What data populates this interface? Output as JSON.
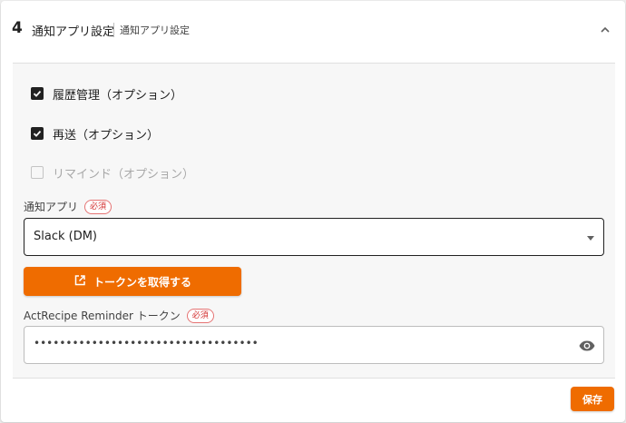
{
  "header": {
    "step_number": "4",
    "title": "通知アプリ設定",
    "subtitle": "通知アプリ設定",
    "collapse_icon": "chevron-up-icon"
  },
  "options": [
    {
      "label": "履歴管理（オプション）",
      "checked": true,
      "disabled": false
    },
    {
      "label": "再送（オプション）",
      "checked": true,
      "disabled": false
    },
    {
      "label": "リマインド（オプション）",
      "checked": false,
      "disabled": true
    }
  ],
  "notify_app": {
    "label": "通知アプリ",
    "required": "必須",
    "value": "Slack (DM)",
    "dropdown_icon": "caret-down-icon"
  },
  "token_button": {
    "label": "トークンを取得する",
    "icon": "open-in-new-icon"
  },
  "reminder_token": {
    "label": "ActRecipe Reminder トークン",
    "required": "必須",
    "value": "•••••••••••••••••••••••••••••••••••",
    "visibility_icon": "eye-icon"
  },
  "footer": {
    "save_label": "保存"
  },
  "colors": {
    "accent": "#ef6c00",
    "required": "#d32f2f",
    "checkbox": "#212121"
  }
}
